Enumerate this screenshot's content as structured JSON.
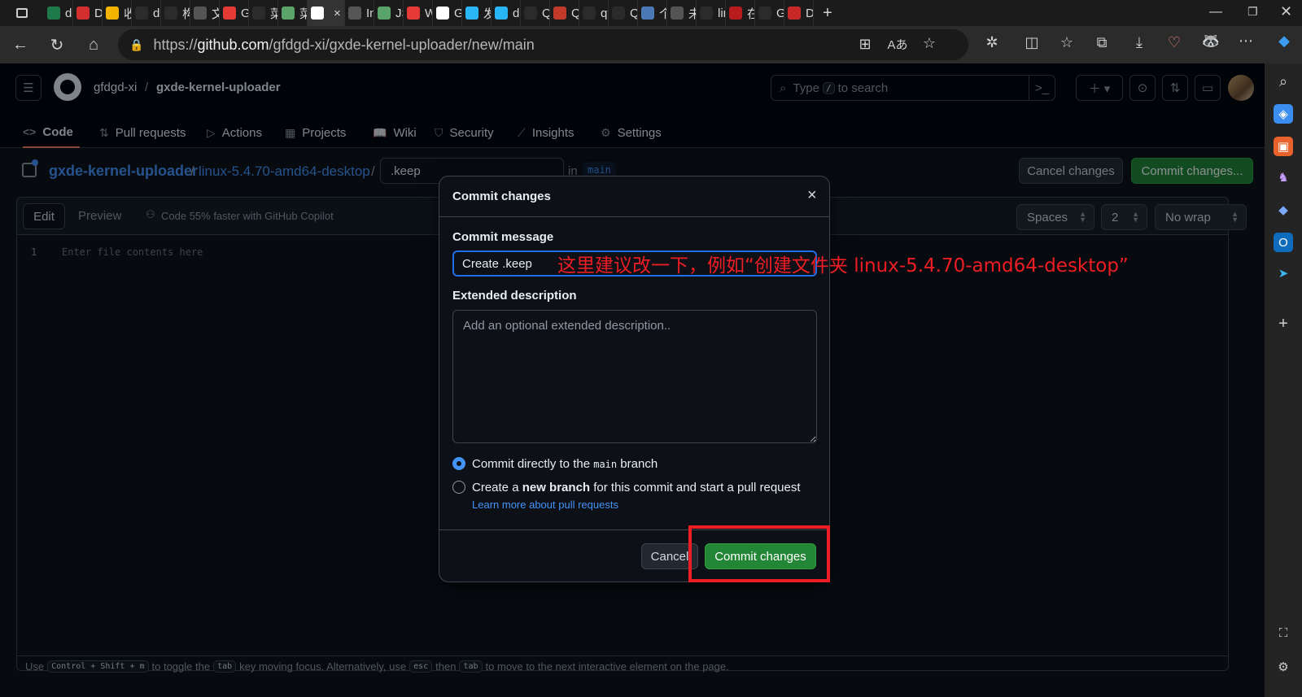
{
  "browser": {
    "tabs": [
      {
        "label": "de",
        "fav_color": "#1e7a4a"
      },
      {
        "label": "De",
        "fav_color": "#d32f2f"
      },
      {
        "label": "收",
        "fav_color": "#f4b400"
      },
      {
        "label": "dc",
        "fav_color": "#2b2b2b"
      },
      {
        "label": "构",
        "fav_color": "#2b2b2b"
      },
      {
        "label": "文",
        "fav_color": "#555555"
      },
      {
        "label": "GX",
        "fav_color": "#e53935"
      },
      {
        "label": "菜",
        "fav_color": "#2b2b2b"
      },
      {
        "label": "菜",
        "fav_color": "#5aa469"
      },
      {
        "label": "",
        "fav_color": "#ffffff",
        "active": true
      },
      {
        "label": "Ind",
        "fav_color": "#555555"
      },
      {
        "label": "JS",
        "fav_color": "#5aa469"
      },
      {
        "label": "Wi",
        "fav_color": "#e53935"
      },
      {
        "label": "GX",
        "fav_color": "#ffffff"
      },
      {
        "label": "发",
        "fav_color": "#29b6f6"
      },
      {
        "label": "dp",
        "fav_color": "#29b6f6"
      },
      {
        "label": "Qt",
        "fav_color": "#2b2b2b"
      },
      {
        "label": "Qt",
        "fav_color": "#c0392b"
      },
      {
        "label": "qt",
        "fav_color": "#2b2b2b"
      },
      {
        "label": "Qt",
        "fav_color": "#2b2b2b"
      },
      {
        "label": "个",
        "fav_color": "#4a78b5"
      },
      {
        "label": "未",
        "fav_color": "#555555"
      },
      {
        "label": "lin",
        "fav_color": "#2b2b2b"
      },
      {
        "label": "在",
        "fav_color": "#b71c1c"
      },
      {
        "label": "GF",
        "fav_color": "#2b2b2b"
      },
      {
        "label": "Dc",
        "fav_color": "#c62828"
      }
    ],
    "new_tab": "+",
    "url_prefix": "https://",
    "url_host": "github.com",
    "url_path": "/gfdgd-xi/gxde-kernel-uploader/new/main"
  },
  "header": {
    "owner": "gfdgd-xi",
    "separator": "/",
    "repo": "gxde-kernel-uploader",
    "search_placeholder": "Type / to search",
    "search_pre": "Type",
    "search_key": "/",
    "search_post": "to search"
  },
  "repo_nav": [
    {
      "label": "Code",
      "icon": "<>"
    },
    {
      "label": "Pull requests",
      "icon": "⇅"
    },
    {
      "label": "Actions",
      "icon": "▷"
    },
    {
      "label": "Projects",
      "icon": "▦"
    },
    {
      "label": "Wiki",
      "icon": "📖"
    },
    {
      "label": "Security",
      "icon": "⛉"
    },
    {
      "label": "Insights",
      "icon": "⟋"
    },
    {
      "label": "Settings",
      "icon": "⚙"
    }
  ],
  "breadcrumb": {
    "repo": "gxde-kernel-uploader",
    "sep": "/",
    "folder": "linux-5.4.70-amd64-desktop",
    "filename": ".keep",
    "in": "in",
    "branch": "main"
  },
  "actions": {
    "cancel": "Cancel changes",
    "commit": "Commit changes..."
  },
  "editor": {
    "tab_edit": "Edit",
    "tab_preview": "Preview",
    "copilot": "Code 55% faster with GitHub Copilot",
    "indent_mode": "Spaces",
    "indent_size": "2",
    "wrap": "No wrap",
    "line_number": "1",
    "placeholder": "Enter file contents here"
  },
  "footer": {
    "t1": "Use",
    "k1": "Control + Shift + m",
    "t2": "to toggle the",
    "k2": "tab",
    "t3": "key moving focus. Alternatively, use",
    "k3": "esc",
    "t4": "then",
    "k4": "tab",
    "t5": "to move to the next interactive element on the page."
  },
  "dialog": {
    "title": "Commit changes",
    "close": "×",
    "message_label": "Commit message",
    "message_value": "Create .keep",
    "desc_label": "Extended description",
    "desc_placeholder": "Add an optional extended description..",
    "radio1_pre": "Commit directly to the",
    "radio1_branch": "main",
    "radio1_post": "branch",
    "radio2_pre": "Create a",
    "radio2_bold": "new branch",
    "radio2_post": "for this commit and start a pull request",
    "learn_more": "Learn more about pull requests",
    "cancel": "Cancel",
    "commit": "Commit changes"
  },
  "annotation": "这里建议改一下，例如“创建文件夹 linux-5.4.70-amd64-desktop”",
  "colors": {
    "accent_blue": "#1f6feb",
    "commit_green": "#238636",
    "annotation_red": "#ee1d24"
  }
}
